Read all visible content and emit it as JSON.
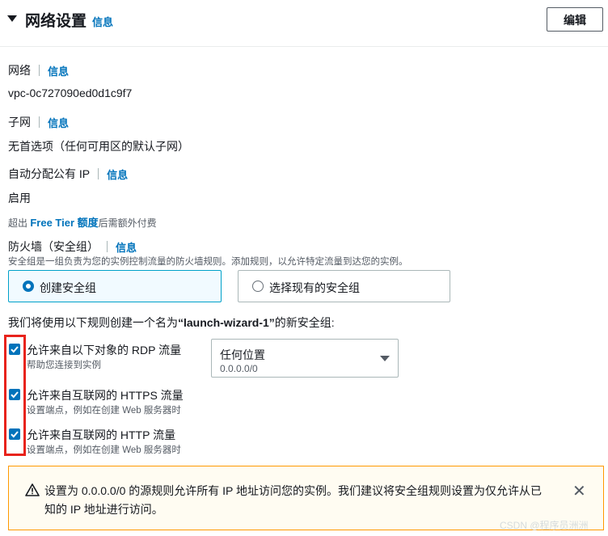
{
  "header": {
    "title": "网络设置",
    "info": "信息",
    "edit_label": "编辑"
  },
  "network": {
    "label": "网络",
    "info": "信息",
    "value": "vpc-0c727090ed0d1c9f7"
  },
  "subnet": {
    "label": "子网",
    "info": "信息",
    "value": "无首选项（任何可用区的默认子网）"
  },
  "public_ip": {
    "label": "自动分配公有 IP",
    "info": "信息",
    "value": "启用"
  },
  "free_tier": {
    "prefix": "超出 ",
    "link": "Free Tier 额度",
    "suffix": "后需额外付费"
  },
  "firewall": {
    "label": "防火墙（安全组）",
    "info": "信息",
    "description": "安全组是一组负责为您的实例控制流量的防火墙规则。添加规则，以允许特定流量到达您的实例。",
    "options": [
      {
        "label": "创建安全组",
        "selected": true
      },
      {
        "label": "选择现有的安全组",
        "selected": false
      }
    ]
  },
  "rules": {
    "intro_prefix": "我们将使用以下规则创建一个名为",
    "group_name": "“launch-wizard-1”",
    "intro_suffix": "的新安全组:",
    "items": [
      {
        "label": "允许来自以下对象的 RDP 流量",
        "description": "帮助您连接到实例",
        "checked": true
      },
      {
        "label": "允许来自互联网的 HTTPS 流量",
        "description": "设置端点，例如在创建 Web 服务器时",
        "checked": true
      },
      {
        "label": "允许来自互联网的 HTTP 流量",
        "description": "设置端点，例如在创建 Web 服务器时",
        "checked": true
      }
    ],
    "source_select": {
      "value": "任何位置",
      "sub": "0.0.0.0/0"
    }
  },
  "warning": {
    "text": "设置为 0.0.0.0/0 的源规则允许所有 IP 地址访问您的实例。我们建议将安全组规则设置为仅允许从已知的 IP 地址进行访问。",
    "close": "✕"
  },
  "watermark": "CSDN @程序员洲洲",
  "colors": {
    "accent": "#0073bb",
    "warning_border": "#ff9900",
    "highlight": "#e8231c"
  }
}
